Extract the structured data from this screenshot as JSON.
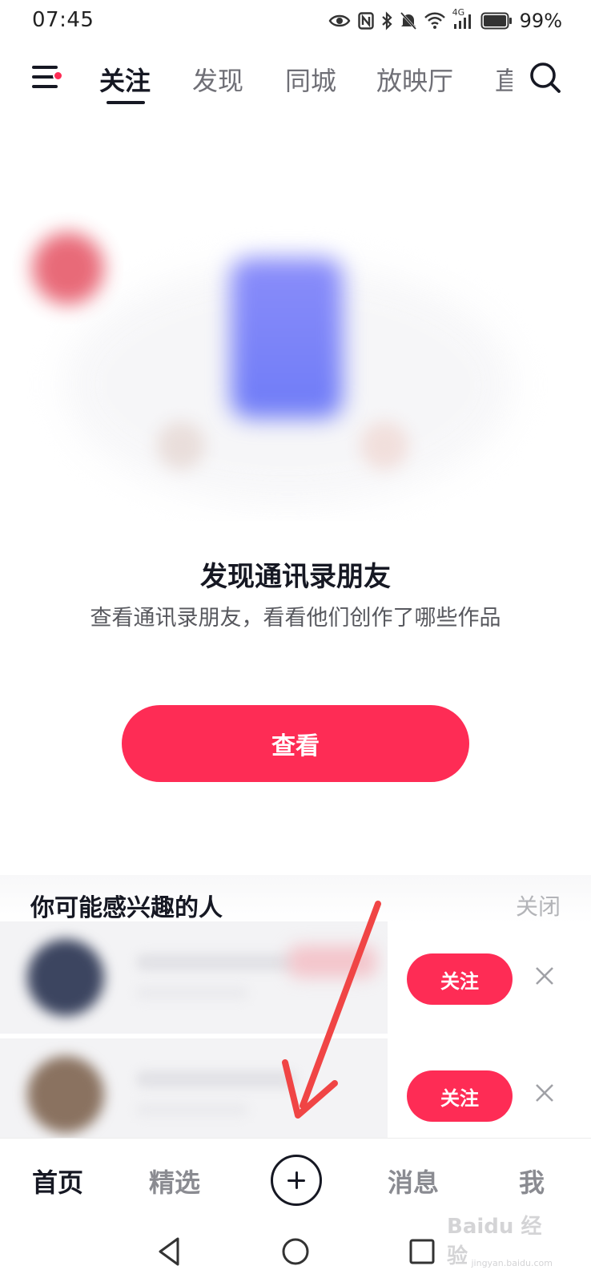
{
  "status_bar": {
    "time": "07:45",
    "battery": "99%",
    "network": "4G",
    "icons": [
      "eye-icon",
      "nfc-icon",
      "bluetooth-icon",
      "mute-icon",
      "wifi-icon",
      "signal-icon",
      "battery-icon"
    ]
  },
  "top_nav": {
    "tabs": [
      {
        "label": "关注",
        "active": true
      },
      {
        "label": "发现",
        "active": false
      },
      {
        "label": "同城",
        "active": false
      },
      {
        "label": "放映厅",
        "active": false
      },
      {
        "label": "直",
        "active": false
      }
    ],
    "menu_badge": true
  },
  "discover": {
    "title": "发现通讯录朋友",
    "description": "查看通讯录朋友，看看他们创作了哪些作品",
    "button_label": "查看"
  },
  "suggestions": {
    "title": "你可能感兴趣的人",
    "close_label": "关闭",
    "rows": [
      {
        "follow_label": "关注"
      },
      {
        "follow_label": "关注"
      }
    ]
  },
  "bottom_bar": {
    "tabs": [
      {
        "label": "首页",
        "active": true
      },
      {
        "label": "精选",
        "active": false
      },
      {
        "label": "消息",
        "active": false
      },
      {
        "label": "我",
        "active": false
      }
    ]
  },
  "watermark": {
    "text": "Baidu 经验",
    "sub": "jingyan.baidu.com"
  },
  "colors": {
    "accent": "#fe2c55",
    "text_primary": "#161823",
    "text_secondary": "#6f6f76",
    "annotation_arrow": "#f04545"
  }
}
